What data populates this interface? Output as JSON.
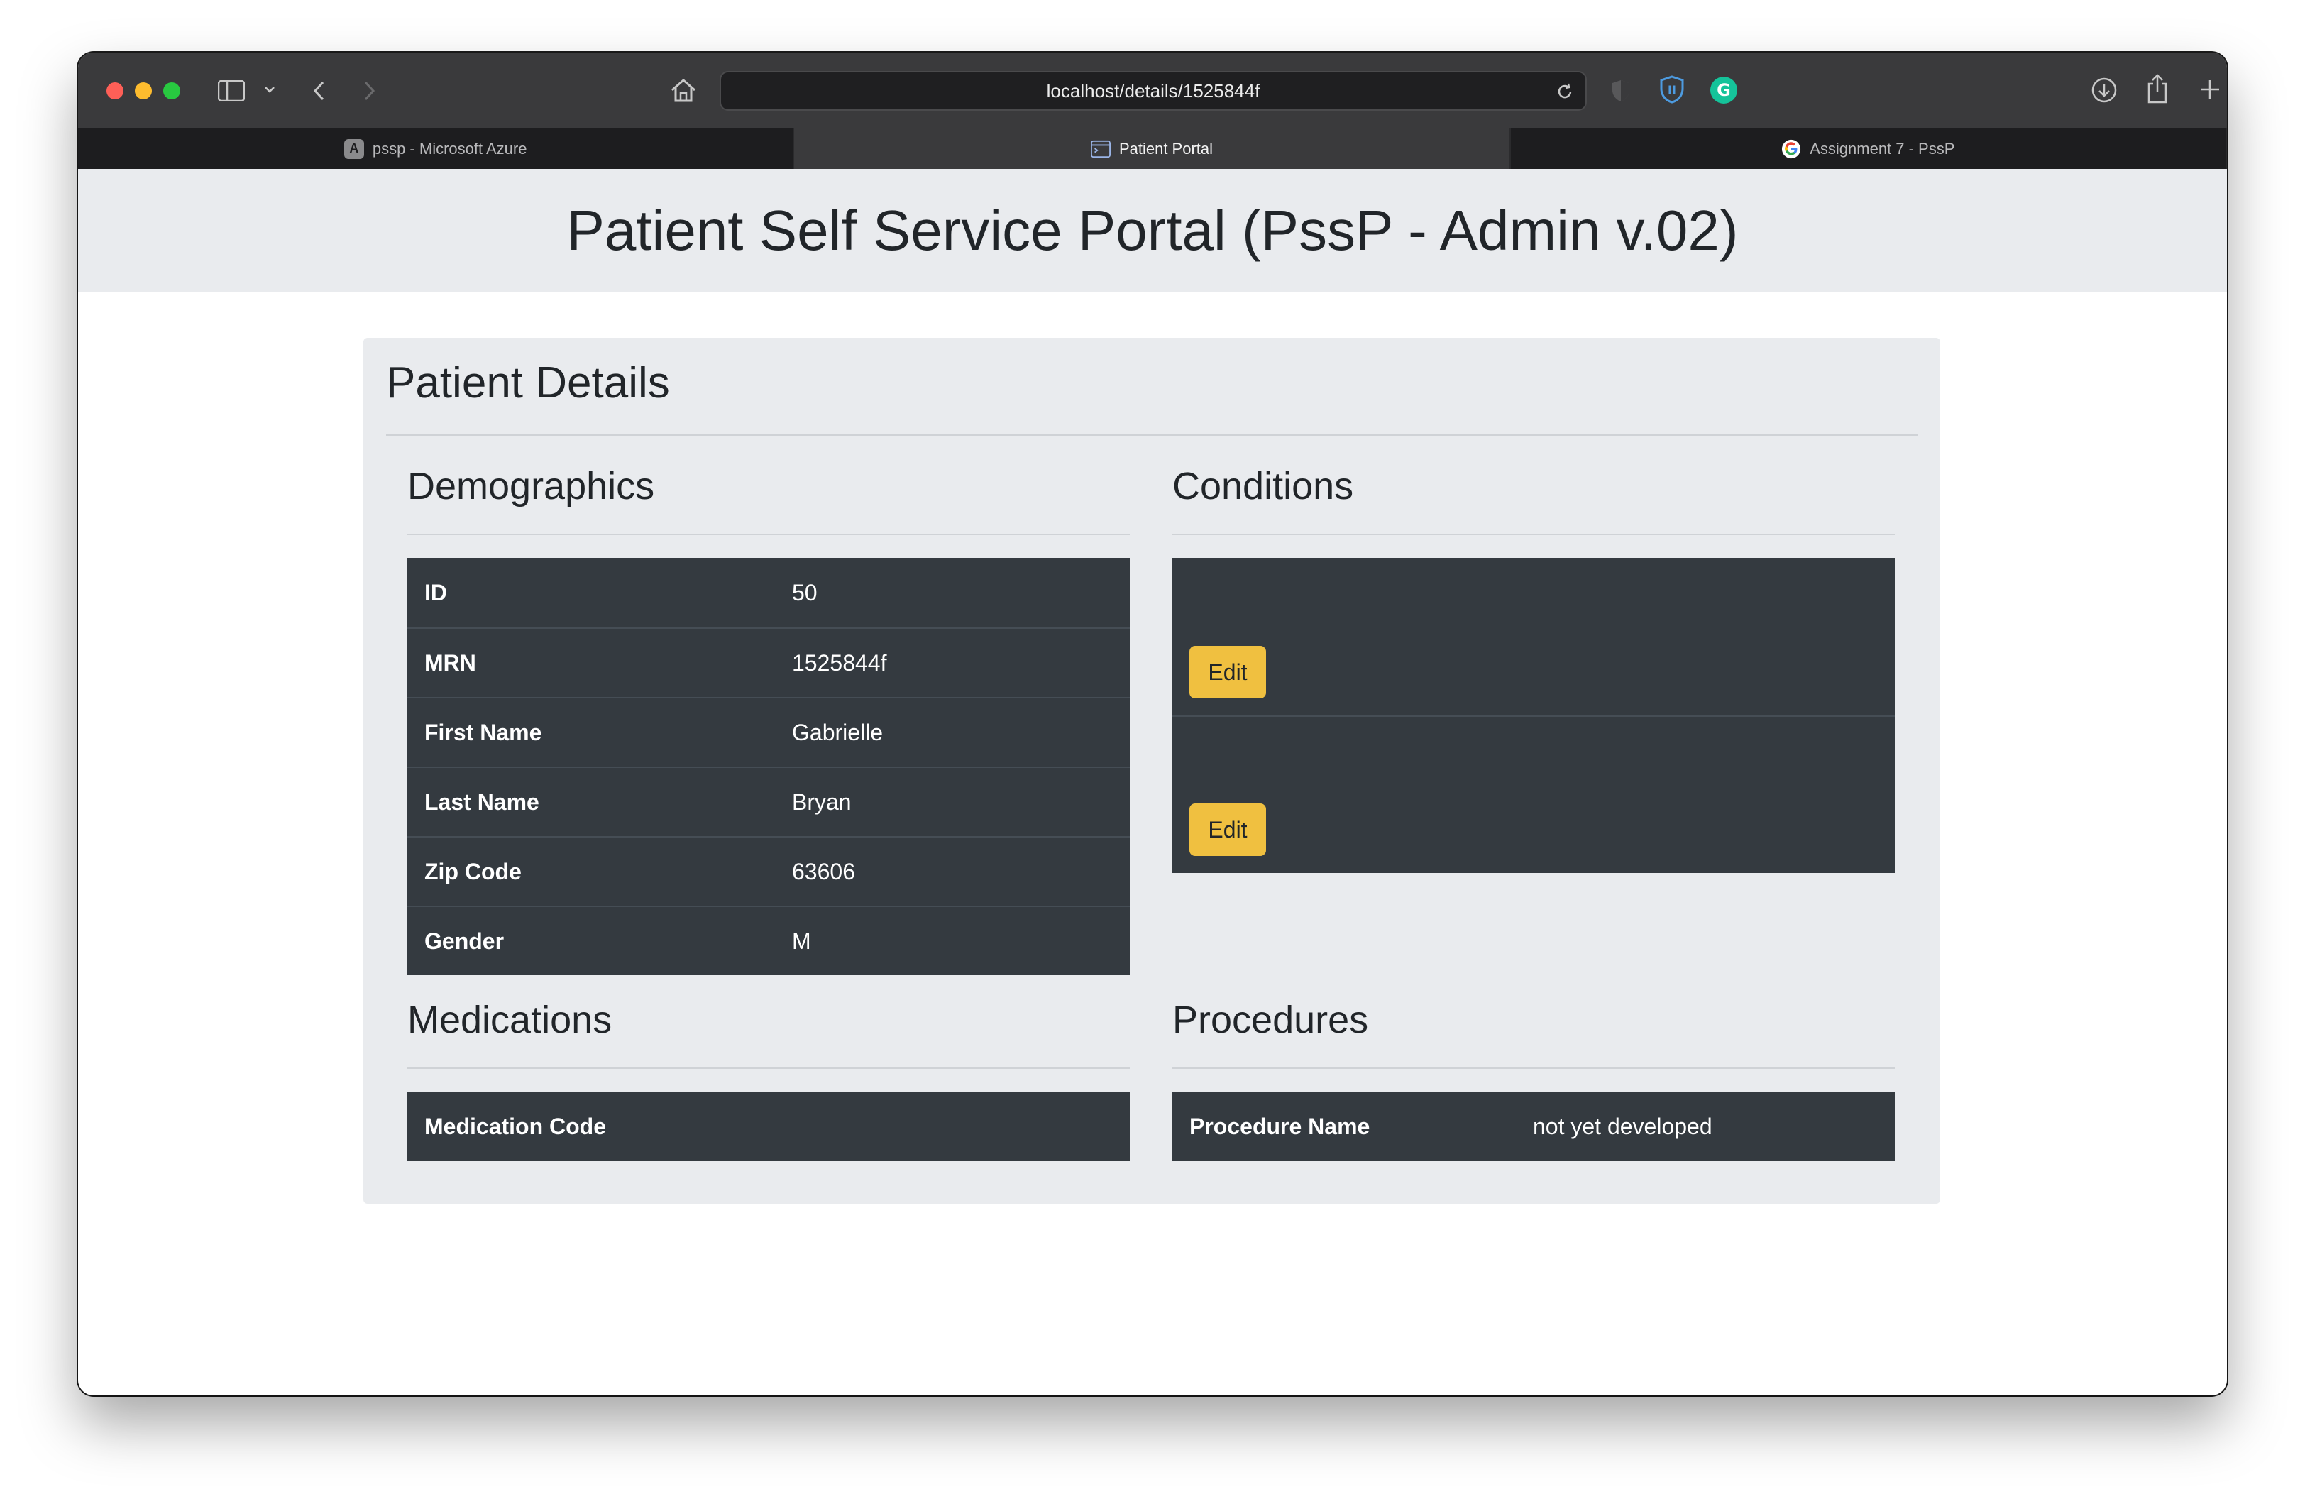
{
  "browser": {
    "url": "localhost/details/1525844f",
    "tabs": [
      {
        "label": "pssp - Microsoft Azure",
        "favicon": "A"
      },
      {
        "label": "Patient Portal"
      },
      {
        "label": "Assignment 7 - PssP"
      }
    ]
  },
  "page": {
    "title": "Patient Self Service Portal (PssP - Admin v.02)",
    "card_title": "Patient Details"
  },
  "demographics": {
    "heading": "Demographics",
    "rows": [
      {
        "label": "ID",
        "value": "50"
      },
      {
        "label": "MRN",
        "value": "1525844f"
      },
      {
        "label": "First Name",
        "value": "Gabrielle"
      },
      {
        "label": "Last Name",
        "value": "Bryan"
      },
      {
        "label": "Zip Code",
        "value": "63606"
      },
      {
        "label": "Gender",
        "value": "M"
      }
    ]
  },
  "conditions": {
    "heading": "Conditions",
    "rows": [
      {
        "edit_label": "Edit"
      },
      {
        "edit_label": "Edit"
      }
    ]
  },
  "medications": {
    "heading": "Medications",
    "rows": [
      {
        "label": "Medication Code",
        "value": ""
      }
    ]
  },
  "procedures": {
    "heading": "Procedures",
    "rows": [
      {
        "label": "Procedure Name",
        "value": "not yet developed"
      }
    ]
  },
  "colors": {
    "table_bg": "#343a40",
    "band_bg": "#e9ebee",
    "edit_button": "#f0c040"
  }
}
